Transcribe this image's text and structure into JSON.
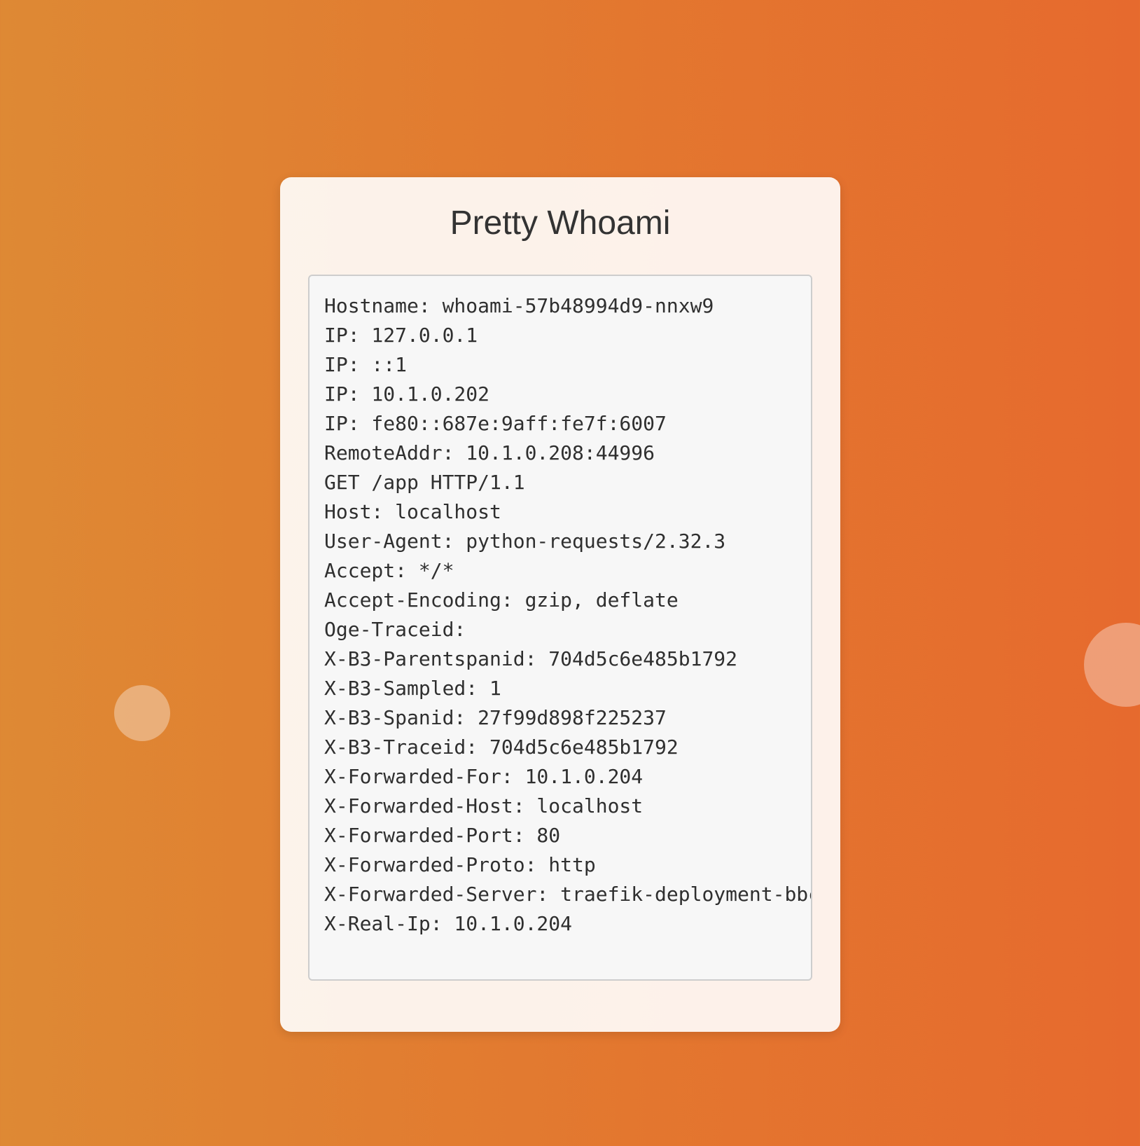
{
  "page": {
    "title": "Pretty Whoami",
    "background_colors": [
      "#de8934",
      "#e66a2e"
    ]
  },
  "output_lines": [
    "Hostname: whoami-57b48994d9-nnxw9",
    "IP: 127.0.0.1",
    "IP: ::1",
    "IP: 10.1.0.202",
    "IP: fe80::687e:9aff:fe7f:6007",
    "RemoteAddr: 10.1.0.208:44996",
    "GET /app HTTP/1.1",
    "Host: localhost",
    "User-Agent: python-requests/2.32.3",
    "Accept: */*",
    "Accept-Encoding: gzip, deflate",
    "Oge-Traceid:",
    "X-B3-Parentspanid: 704d5c6e485b1792",
    "X-B3-Sampled: 1",
    "X-B3-Spanid: 27f99d898f225237",
    "X-B3-Traceid: 704d5c6e485b1792",
    "X-Forwarded-For: 10.1.0.204",
    "X-Forwarded-Host: localhost",
    "X-Forwarded-Port: 80",
    "X-Forwarded-Proto: http",
    "X-Forwarded-Server: traefik-deployment-bbc",
    "X-Real-Ip: 10.1.0.204"
  ]
}
